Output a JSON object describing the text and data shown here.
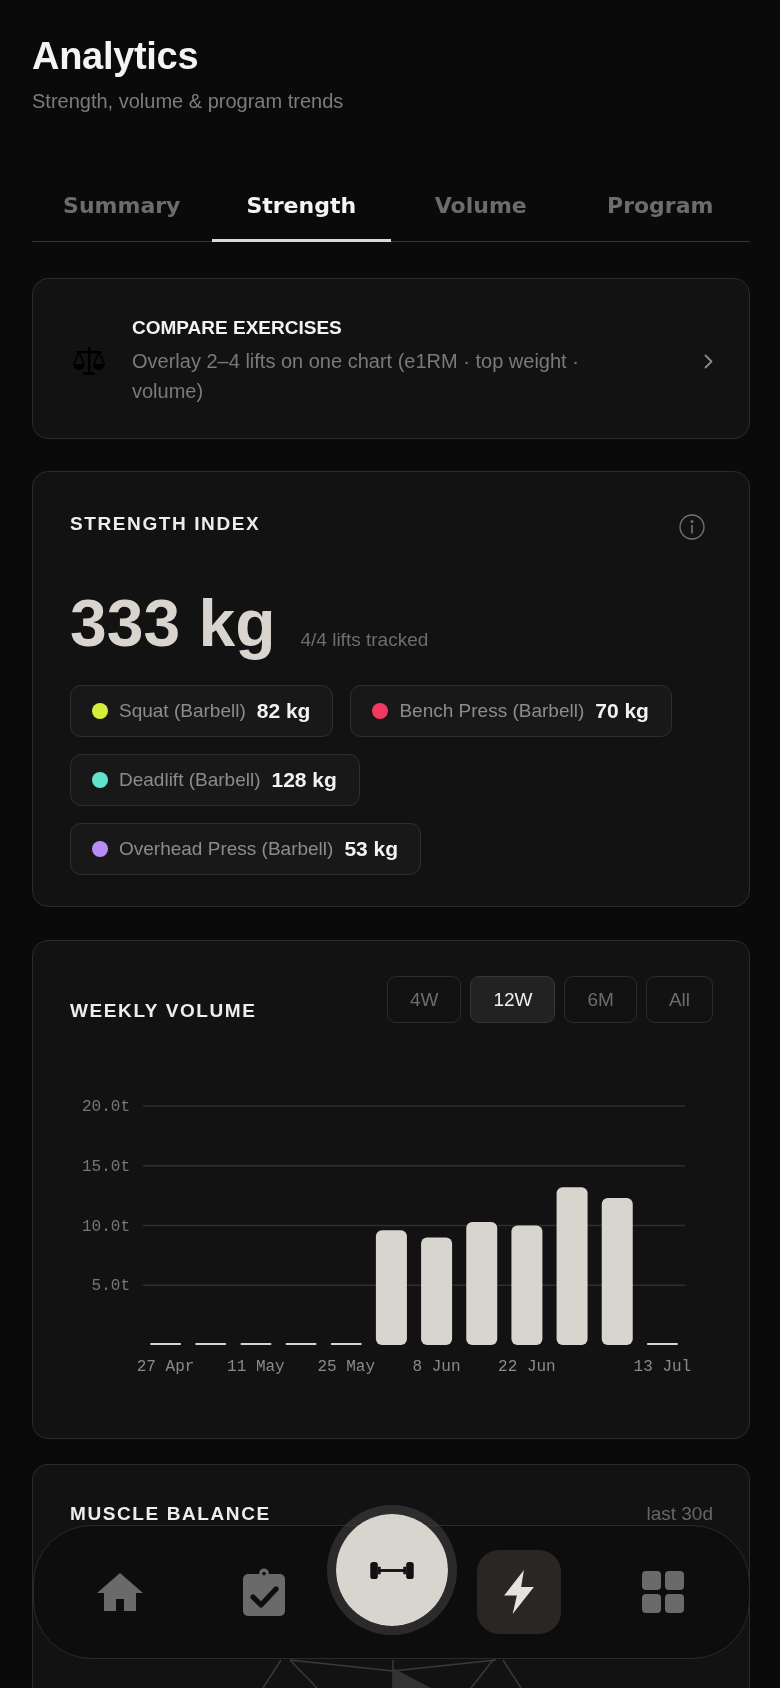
{
  "header": {
    "title": "Analytics",
    "subtitle": "Strength, volume & program trends"
  },
  "tabs": [
    {
      "label": "Summary",
      "selected": false
    },
    {
      "label": "Strength",
      "selected": true
    },
    {
      "label": "Volume",
      "selected": false
    },
    {
      "label": "Program",
      "selected": false
    }
  ],
  "compare_card": {
    "title": "COMPARE EXERCISES",
    "description": "Overlay 2–4 lifts on one chart (e1RM · top weight · volume)"
  },
  "strength_index": {
    "title": "STRENGTH INDEX",
    "total": "333 kg",
    "caption": "4/4 lifts tracked",
    "lifts": [
      {
        "name": "Squat (Barbell)",
        "weight": "82 kg",
        "color": "#d4ee3b"
      },
      {
        "name": "Bench Press (Barbell)",
        "weight": "70 kg",
        "color": "#f2385e"
      },
      {
        "name": "Deadlift (Barbell)",
        "weight": "128 kg",
        "color": "#5fe3cb"
      },
      {
        "name": "Overhead Press (Barbell)",
        "weight": "53 kg",
        "color": "#b68cf7"
      }
    ]
  },
  "weekly_volume": {
    "title": "WEEKLY VOLUME",
    "ranges": [
      {
        "label": "4W",
        "selected": false
      },
      {
        "label": "12W",
        "selected": true
      },
      {
        "label": "6M",
        "selected": false
      },
      {
        "label": "All",
        "selected": false
      }
    ],
    "chart_data": {
      "type": "bar",
      "grid": true,
      "categories": [
        "27 Apr",
        null,
        "11 May",
        null,
        "25 May",
        null,
        "8 Jun",
        null,
        "22 Jun",
        null,
        null,
        "13 Jul"
      ],
      "values": [
        0,
        0,
        0,
        0,
        0,
        9.6,
        9.0,
        10.3,
        10.0,
        13.2,
        12.3,
        0
      ],
      "ylim": [
        0,
        20
      ],
      "yticks": [
        {
          "value": 5,
          "label": "5.0t"
        },
        {
          "value": 10,
          "label": "10.0t"
        },
        {
          "value": 15,
          "label": "15.0t"
        },
        {
          "value": 20,
          "label": "20.0t"
        }
      ]
    }
  },
  "muscle_balance": {
    "title": "MUSCLE BALANCE",
    "period": "last 30d"
  },
  "bottom_nav": [
    {
      "kind": "home",
      "selected": false
    },
    {
      "kind": "log",
      "selected": false
    },
    {
      "kind": "workout",
      "selected": false
    },
    {
      "kind": "analytics",
      "selected": true
    },
    {
      "kind": "more",
      "selected": false
    }
  ]
}
